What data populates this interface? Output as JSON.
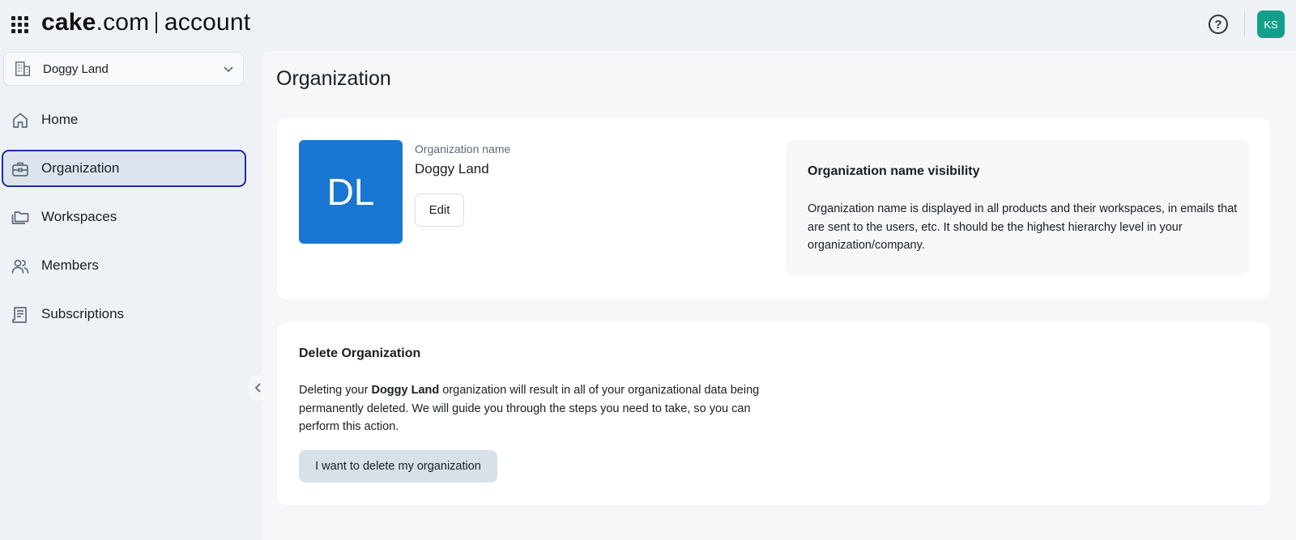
{
  "header": {
    "logo_brand": "cake",
    "logo_domain": ".com",
    "logo_product": "account",
    "apps_icon": "apps-grid-icon",
    "help_icon": "help-circle-icon",
    "help_glyph": "?",
    "user_initials": "KS",
    "avatar_color": "#13a08a"
  },
  "sidebar": {
    "org_selector": {
      "label": "Doggy Land",
      "icon": "building-icon"
    },
    "items": [
      {
        "label": "Home",
        "icon": "home-icon",
        "active": false
      },
      {
        "label": "Organization",
        "icon": "briefcase-icon",
        "active": true
      },
      {
        "label": "Workspaces",
        "icon": "folders-icon",
        "active": false
      },
      {
        "label": "Members",
        "icon": "users-icon",
        "active": false
      },
      {
        "label": "Subscriptions",
        "icon": "receipt-icon",
        "active": false
      }
    ],
    "active_border_color": "#1d2fa8"
  },
  "main": {
    "title": "Organization",
    "org_card": {
      "initials": "DL",
      "initials_bg": "#1976d2",
      "field_label": "Organization name",
      "field_value": "Doggy Land",
      "edit_label": "Edit",
      "visibility_title": "Organization name visibility",
      "visibility_text": "Organization name is displayed in all products and their workspaces, in emails that are sent to the users, etc. It should be the highest hierarchy level in your organization/company."
    },
    "delete_card": {
      "title": "Delete Organization",
      "text_before": "Deleting your ",
      "org_name": "Doggy Land",
      "text_after": " organization will result in all of your organizational data being permanently deleted. We will guide you through the steps you need to take, so you can perform this action.",
      "button_label": "I want to delete my organization"
    }
  }
}
